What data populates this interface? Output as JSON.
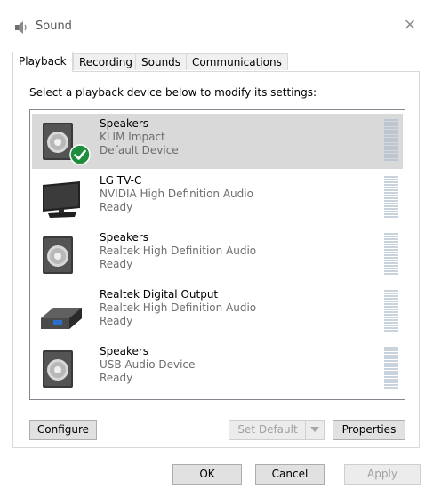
{
  "window": {
    "title": "Sound",
    "close_glyph": "×"
  },
  "tabs": [
    {
      "label": "Playback",
      "active": true
    },
    {
      "label": "Recording",
      "active": false
    },
    {
      "label": "Sounds",
      "active": false
    },
    {
      "label": "Communications",
      "active": false
    }
  ],
  "playback": {
    "instruction": "Select a playback device below to modify its settings:",
    "devices": [
      {
        "name": "Speakers",
        "driver": "KLIM Impact",
        "status": "Default Device",
        "icon": "speaker-icon",
        "selected": true,
        "default": true
      },
      {
        "name": "LG TV-C",
        "driver": "NVIDIA High Definition Audio",
        "status": "Ready",
        "icon": "monitor-icon",
        "selected": false,
        "default": false
      },
      {
        "name": "Speakers",
        "driver": "Realtek High Definition Audio",
        "status": "Ready",
        "icon": "speaker-icon",
        "selected": false,
        "default": false
      },
      {
        "name": "Realtek Digital Output",
        "driver": "Realtek High Definition Audio",
        "status": "Ready",
        "icon": "digital-output-icon",
        "selected": false,
        "default": false
      },
      {
        "name": "Speakers",
        "driver": "USB Audio Device",
        "status": "Ready",
        "icon": "speaker-icon",
        "selected": false,
        "default": false
      }
    ],
    "configure_label": "Configure",
    "set_default_label": "Set Default",
    "properties_label": "Properties"
  },
  "footer": {
    "ok_label": "OK",
    "cancel_label": "Cancel",
    "apply_label": "Apply"
  },
  "colors": {
    "selected_row": "#d9d9d9",
    "check_green": "#1e8e3e",
    "meter": "#c8d3dd"
  }
}
